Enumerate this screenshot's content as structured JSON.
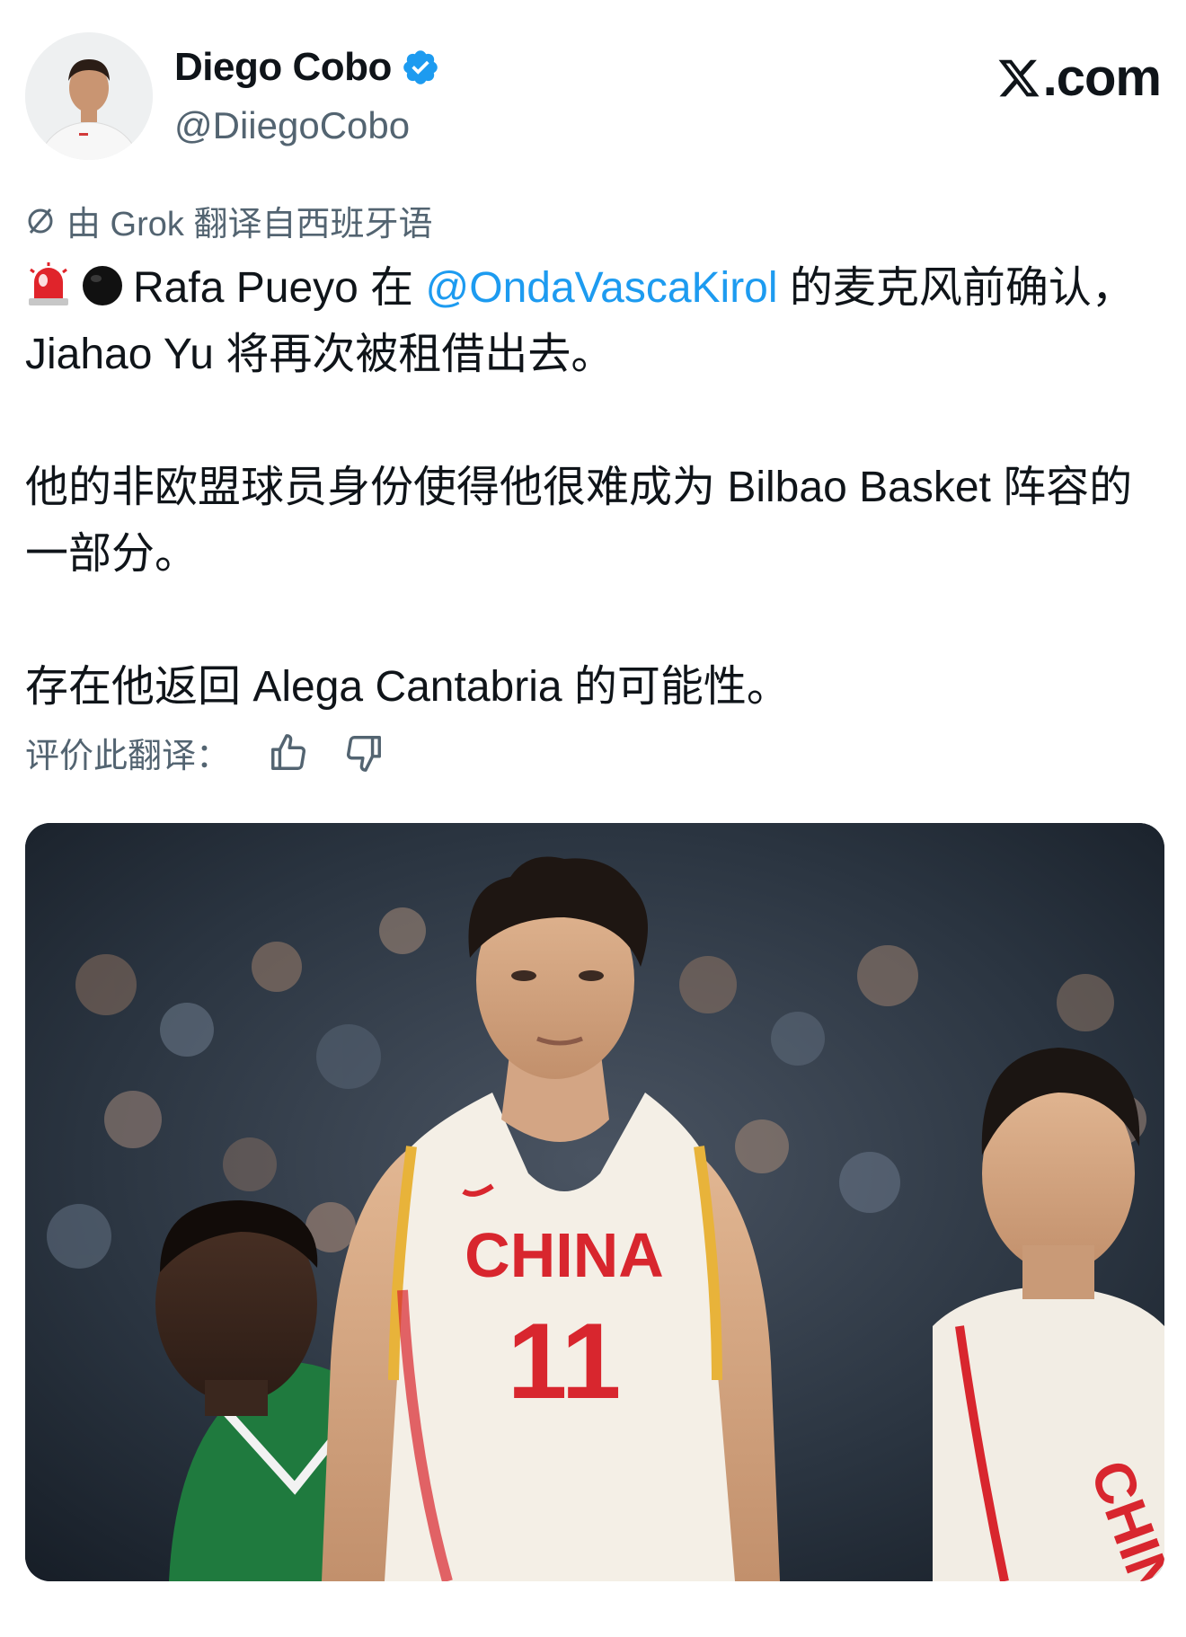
{
  "author": {
    "display_name": "Diego Cobo",
    "handle": "@DiiegoCobo",
    "verified_icon": "verified-badge-icon",
    "avatar_icon": "avatar"
  },
  "brand": {
    "label": ".com",
    "logo_icon": "x-logo-icon"
  },
  "translation": {
    "note": "由 Grok 翻译自西班牙语",
    "icon": "translate-icon"
  },
  "tweet": {
    "line1_after_emoji": "Rafa Pueyo 在 ",
    "mention": "@OndaVascaKirol",
    "line1_end": " 的麦克风前确认，Jiahao Yu 将再次被租借出去。",
    "para2": "他的非欧盟球员身份使得他很难成为 Bilbao Basket 阵容的一部分。",
    "para3": "存在他返回 Alega Cantabria 的可能性。",
    "emoji1": "siren-icon",
    "emoji2": "black-circle-icon"
  },
  "rating": {
    "label": "评价此翻译：",
    "like_icon": "thumbs-up-icon",
    "dislike_icon": "thumbs-down-icon"
  },
  "media": {
    "jersey_text": "CHINA",
    "jersey_number": "11",
    "colors": {
      "jersey": "#f4efe6",
      "jersey_red": "#d8262e",
      "jersey_trim": "#e8b33a",
      "opponent_green": "#1f7a3e",
      "crowd": "#2a3440"
    }
  },
  "colors": {
    "text": "#0f1419",
    "secondary": "#536471",
    "link": "#1d9bf0"
  }
}
